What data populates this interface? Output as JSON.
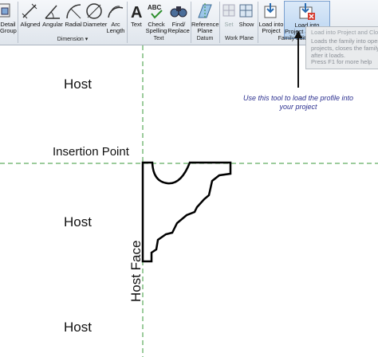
{
  "ribbon": {
    "tools": {
      "detail_group": "Detail\nGroup",
      "aligned": "Aligned",
      "angular": "Angular",
      "radial": "Radial",
      "diameter": "Diameter",
      "arc_length": "Arc\nLength",
      "text": "Text",
      "check_spelling": "Check\nSpelling",
      "find_replace": "Find/\nReplace",
      "reference_plane": "Reference\nPlane",
      "set": "Set",
      "show": "Show",
      "load_into_project": "Load into\nProject",
      "load_into_project_close": "Load into\nProject and Close"
    },
    "panels": {
      "dimension": "Dimension",
      "text": "Text",
      "datum": "Datum",
      "work_plane": "Work Plane",
      "family_editor": "Family Editor"
    }
  },
  "tooltip": {
    "title": "Load into Project and Close",
    "description": "Loads the family into open projects, closes the family after it loads.",
    "help": "Press F1 for more help"
  },
  "canvas": {
    "host_top": "Host",
    "insertion_point": "Insertion Point",
    "host_middle": "Host",
    "host_face": "Host Face",
    "host_bottom": "Host",
    "annotation": "Use this tool to load the profile into your project"
  },
  "colors": {
    "reference_line": "#3a9a3a",
    "profile": "#000000",
    "annotation_text": "#2b2f8f",
    "ribbon_highlight": "#b9d4f1"
  }
}
